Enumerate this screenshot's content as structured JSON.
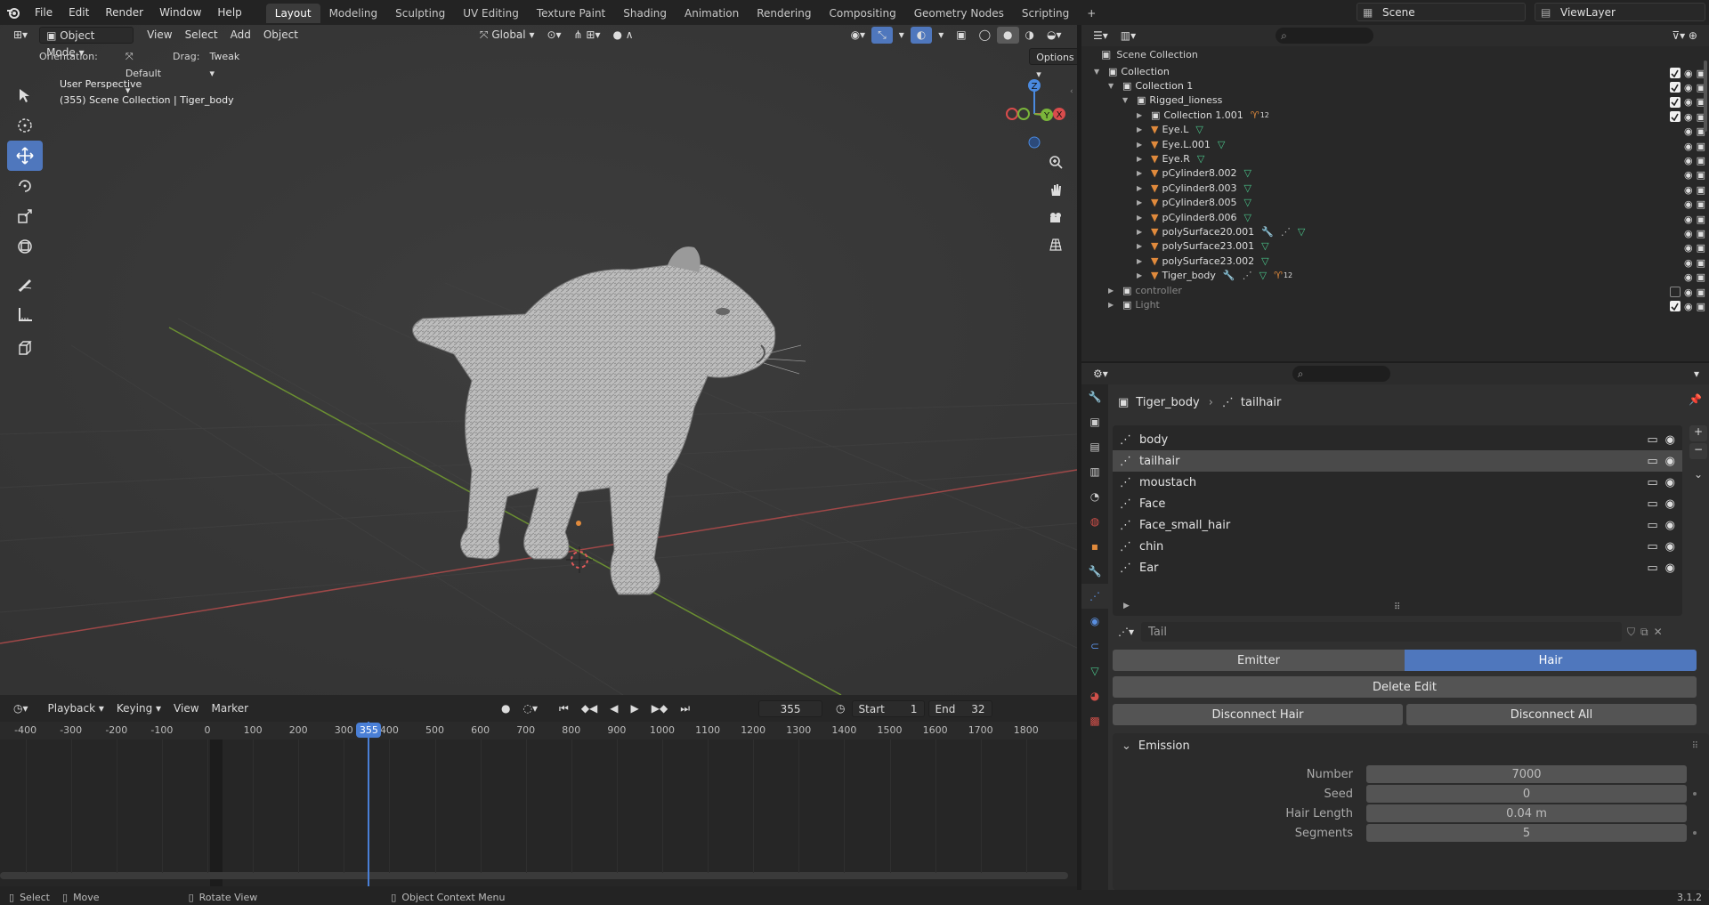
{
  "topbar": {
    "menus": [
      "File",
      "Edit",
      "Render",
      "Window",
      "Help"
    ],
    "workspaces": [
      "Layout",
      "Modeling",
      "Sculpting",
      "UV Editing",
      "Texture Paint",
      "Shading",
      "Animation",
      "Rendering",
      "Compositing",
      "Geometry Nodes",
      "Scripting"
    ],
    "active_workspace": "Layout",
    "add_tab": "+",
    "scene": "Scene",
    "view_layer": "ViewLayer"
  },
  "viewport": {
    "mode": "Object Mode",
    "menus": [
      "View",
      "Select",
      "Add",
      "Object"
    ],
    "transform_orientation": "Global",
    "orientation_label": "Orientation:",
    "orientation_value": "Default",
    "drag_label": "Drag:",
    "drag_value": "Tweak",
    "options": "Options",
    "perspective": "User Perspective",
    "context": "(355) Scene Collection | Tiger_body",
    "gizmo": {
      "x": "X",
      "y": "Y",
      "z": "Z"
    }
  },
  "timeline": {
    "menus": [
      "Playback",
      "Keying",
      "View",
      "Marker"
    ],
    "current_frame": "355",
    "start_label": "Start",
    "start": "1",
    "end_label": "End",
    "end": "32",
    "ticks": [
      "-400",
      "-300",
      "-200",
      "-100",
      "0",
      "100",
      "200",
      "300",
      "400",
      "500",
      "600",
      "700",
      "800",
      "900",
      "1000",
      "1100",
      "1200",
      "1300",
      "1400",
      "1500",
      "1600",
      "1700",
      "1800"
    ],
    "playhead": "355"
  },
  "outliner": {
    "root": "Scene Collection",
    "rows": [
      {
        "name": "Collection"
      },
      {
        "name": "Collection 1"
      },
      {
        "name": "Rigged_lioness"
      },
      {
        "name": "Collection 1.001",
        "badge": "12"
      },
      {
        "name": "Eye.L"
      },
      {
        "name": "Eye.L.001"
      },
      {
        "name": "Eye.R"
      },
      {
        "name": "pCylinder8.002"
      },
      {
        "name": "pCylinder8.003"
      },
      {
        "name": "pCylinder8.005"
      },
      {
        "name": "pCylinder8.006"
      },
      {
        "name": "polySurface20.001"
      },
      {
        "name": "polySurface23.001"
      },
      {
        "name": "polySurface23.002"
      },
      {
        "name": "Tiger_body",
        "badge": "12"
      },
      {
        "name": "controller"
      },
      {
        "name": "Light"
      }
    ]
  },
  "properties": {
    "breadcrumb_object": "Tiger_body",
    "breadcrumb_system": "tailhair",
    "particle_systems": [
      "body",
      "tailhair",
      "moustach",
      "Face",
      "Face_small_hair",
      "chin",
      "Ear"
    ],
    "selected_system": "tailhair",
    "settings_name": "Tail",
    "type_options": [
      "Emitter",
      "Hair"
    ],
    "type_selected": "Hair",
    "delete_edit": "Delete Edit",
    "disconnect_hair": "Disconnect Hair",
    "disconnect_all": "Disconnect All",
    "emission_panel": "Emission",
    "fields": [
      {
        "label": "Number",
        "value": "7000"
      },
      {
        "label": "Seed",
        "value": "0"
      },
      {
        "label": "Hair Length",
        "value": "0.04 m"
      },
      {
        "label": "Segments",
        "value": "5"
      }
    ]
  },
  "statusbar": {
    "select": "Select",
    "move": "Move",
    "rotate": "Rotate View",
    "context_menu": "Object Context Menu",
    "version": "3.1.2"
  },
  "colors": {
    "accent": "#4f77bd",
    "x_axis": "#d94c4c",
    "y_axis": "#7ab53a",
    "z_axis": "#4a8ae0",
    "object_orange": "#e08a3c"
  }
}
